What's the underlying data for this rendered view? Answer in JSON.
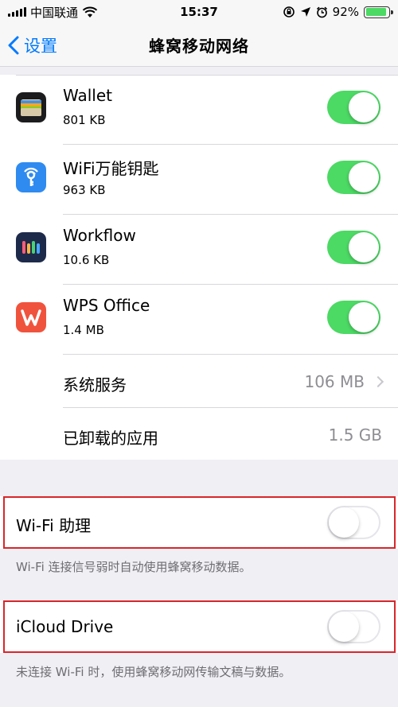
{
  "status_bar": {
    "carrier": "中国联通",
    "time": "15:37",
    "battery": "92%",
    "battery_level": 0.92
  },
  "nav": {
    "back_label": "设置",
    "title": "蜂窝移动网络"
  },
  "apps": [
    {
      "name": "Wallet",
      "size": "801 KB",
      "icon": "wallet-icon",
      "enabled": true
    },
    {
      "name": "WiFi万能钥匙",
      "size": "963 KB",
      "icon": "wifi-key-icon",
      "enabled": true
    },
    {
      "name": "Workflow",
      "size": "10.6 KB",
      "icon": "workflow-icon",
      "enabled": true
    },
    {
      "name": "WPS Office",
      "size": "1.4 MB",
      "icon": "wps-office-icon",
      "enabled": true
    }
  ],
  "system_services": {
    "label": "系统服务",
    "value": "106 MB"
  },
  "uninstalled_apps": {
    "label": "已卸载的应用",
    "value": "1.5 GB"
  },
  "wifi_assist": {
    "label": "Wi-Fi 助理",
    "enabled": false,
    "footnote": "Wi-Fi 连接信号弱时自动使用蜂窝移动数据。"
  },
  "icloud_drive": {
    "label": "iCloud Drive",
    "enabled": false,
    "footnote": "未连接 Wi-Fi 时，使用蜂窝移动网传输文稿与数据。"
  },
  "colors": {
    "accent": "#007aff",
    "toggle_on": "#4cd964",
    "highlight": "#d9262a"
  }
}
